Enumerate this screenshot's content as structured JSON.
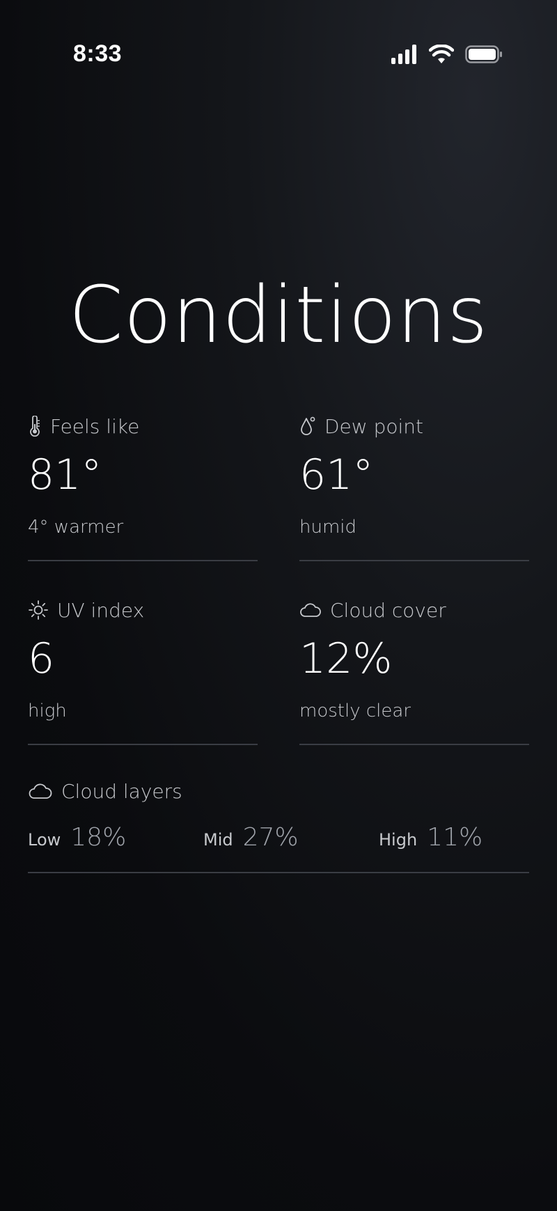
{
  "status_bar": {
    "time": "8:33",
    "icons": [
      "signal-icon",
      "wifi-icon",
      "battery-icon"
    ]
  },
  "title": "Conditions",
  "cards": {
    "feels_like": {
      "label": "Feels like",
      "value": "81°",
      "desc": "4° warmer",
      "icon": "thermometer-icon"
    },
    "dew_point": {
      "label": "Dew point",
      "value": "61°",
      "desc": "humid",
      "icon": "droplet-icon"
    },
    "uv_index": {
      "label": "UV index",
      "value": "6",
      "desc": "high",
      "icon": "sun-icon"
    },
    "cloud_cover": {
      "label": "Cloud cover",
      "value": "12%",
      "desc": "mostly clear",
      "icon": "cloud-icon"
    }
  },
  "cloud_layers": {
    "label": "Cloud layers",
    "icon": "cloud-icon",
    "low": {
      "name": "Low",
      "value": "18%"
    },
    "mid": {
      "name": "Mid",
      "value": "27%"
    },
    "high": {
      "name": "High",
      "value": "11%"
    }
  },
  "colors": {
    "background": "#0b0c0f",
    "primary_text": "#ffffff",
    "secondary_text": "#c7c9cd",
    "divider": "#3a3d44"
  }
}
